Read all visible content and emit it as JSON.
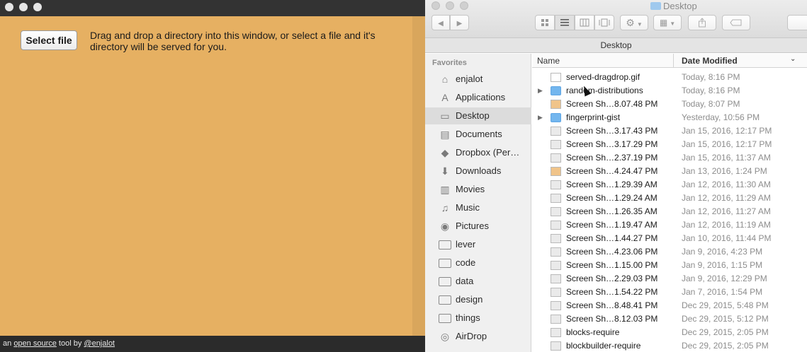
{
  "app": {
    "select_button": "Select file",
    "instructions": "Drag and drop a directory into this window, or select a file and it's directory will be served for you.",
    "footer": {
      "prefix": "an",
      "link1": "open source",
      "middle": "tool by",
      "link2": "@enjalot"
    }
  },
  "finder": {
    "title": "Desktop",
    "path": "Desktop",
    "icons": {
      "back": "◀",
      "forward": "▶",
      "action": "⚙",
      "arrange": "▦",
      "share": "share-icon",
      "tag": "tag-icon"
    },
    "sidebar": {
      "section": "Favorites",
      "items": [
        {
          "label": "enjalot",
          "icon": "⌂"
        },
        {
          "label": "Applications",
          "icon": "A"
        },
        {
          "label": "Desktop",
          "icon": "▭"
        },
        {
          "label": "Documents",
          "icon": "▤"
        },
        {
          "label": "Dropbox (Per…",
          "icon": "◆"
        },
        {
          "label": "Downloads",
          "icon": "⬇"
        },
        {
          "label": "Movies",
          "icon": "▥"
        },
        {
          "label": "Music",
          "icon": "♫"
        },
        {
          "label": "Pictures",
          "icon": "◉"
        },
        {
          "label": "lever",
          "icon": ""
        },
        {
          "label": "code",
          "icon": ""
        },
        {
          "label": "data",
          "icon": ""
        },
        {
          "label": "design",
          "icon": ""
        },
        {
          "label": "things",
          "icon": ""
        },
        {
          "label": "AirDrop",
          "icon": "◎"
        }
      ]
    },
    "list": {
      "col_name": "Name",
      "col_date": "Date Modified",
      "rows": [
        {
          "name": "served-dragdrop.gif",
          "date": "Today, 8:16 PM"
        },
        {
          "name": "random-distributions",
          "date": "Today, 8:16 PM"
        },
        {
          "name": "Screen Sh…8.07.48 PM",
          "date": "Today, 8:07 PM"
        },
        {
          "name": "fingerprint-gist",
          "date": "Yesterday, 10:56 PM"
        },
        {
          "name": "Screen Sh…3.17.43 PM",
          "date": "Jan 15, 2016, 12:17 PM"
        },
        {
          "name": "Screen Sh…3.17.29 PM",
          "date": "Jan 15, 2016, 12:17 PM"
        },
        {
          "name": "Screen Sh…2.37.19 PM",
          "date": "Jan 15, 2016, 11:37 AM"
        },
        {
          "name": "Screen Sh…4.24.47 PM",
          "date": "Jan 13, 2016, 1:24 PM"
        },
        {
          "name": "Screen Sh…1.29.39 AM",
          "date": "Jan 12, 2016, 11:30 AM"
        },
        {
          "name": "Screen Sh…1.29.24 AM",
          "date": "Jan 12, 2016, 11:29 AM"
        },
        {
          "name": "Screen Sh…1.26.35 AM",
          "date": "Jan 12, 2016, 11:27 AM"
        },
        {
          "name": "Screen Sh…1.19.47 AM",
          "date": "Jan 12, 2016, 11:19 AM"
        },
        {
          "name": "Screen Sh…1.44.27 PM",
          "date": "Jan 10, 2016, 11:44 PM"
        },
        {
          "name": "Screen Sh…4.23.06 PM",
          "date": "Jan 9, 2016, 4:23 PM"
        },
        {
          "name": "Screen Sh…1.15.00 PM",
          "date": "Jan 9, 2016, 1:15 PM"
        },
        {
          "name": "Screen Sh…2.29.03 PM",
          "date": "Jan 9, 2016, 12:29 PM"
        },
        {
          "name": "Screen Sh…1.54.22 PM",
          "date": "Jan 7, 2016, 1:54 PM"
        },
        {
          "name": "Screen Sh…8.48.41 PM",
          "date": "Dec 29, 2015, 5:48 PM"
        },
        {
          "name": "Screen Sh…8.12.03 PM",
          "date": "Dec 29, 2015, 5:12 PM"
        },
        {
          "name": "blocks-require",
          "date": "Dec 29, 2015, 2:05 PM"
        },
        {
          "name": "blockbuilder-require",
          "date": "Dec 29, 2015, 2:05 PM"
        }
      ]
    }
  }
}
